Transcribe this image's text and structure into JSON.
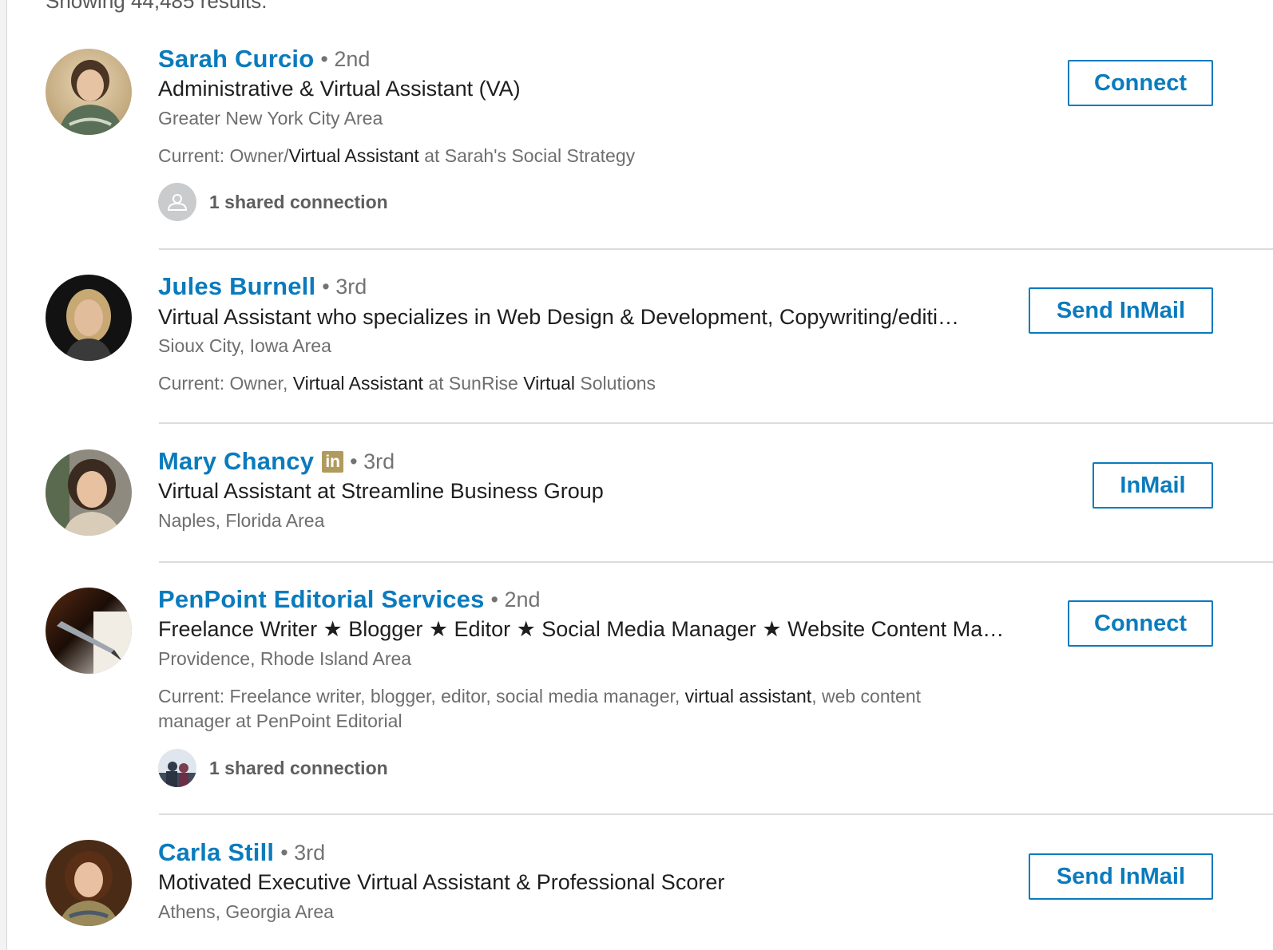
{
  "results_count": "Showing 44,485 results.",
  "results": [
    {
      "name": "Sarah Curcio",
      "degree": "• 2nd",
      "headline": "Administrative & Virtual Assistant (VA)",
      "location": "Greater New York City Area",
      "snippet": {
        "prefix": "Current: Owner/",
        "highlight": "Virtual Assistant",
        "suffix": " at Sarah's Social Strategy"
      },
      "shared": "1 shared connection",
      "action": "Connect"
    },
    {
      "name": "Jules Burnell",
      "degree": "• 3rd",
      "headline": "Virtual Assistant who specializes in Web Design & Development, Copywriting/editi…",
      "location": "Sioux City, Iowa Area",
      "snippet": {
        "prefix": "Current: Owner, ",
        "highlight": "Virtual Assistant",
        "middle": " at SunRise ",
        "highlight2": "Virtual",
        "suffix": " Solutions"
      },
      "action": "Send InMail"
    },
    {
      "name": "Mary Chancy",
      "badge": "in",
      "degree": "• 3rd",
      "headline": "Virtual Assistant at Streamline Business Group",
      "location": "Naples, Florida Area",
      "action": "InMail"
    },
    {
      "name": "PenPoint Editorial Services",
      "degree": "• 2nd",
      "headline": "Freelance Writer ★ Blogger ★ Editor ★ Social Media Manager ★ Website Content Ma…",
      "location": "Providence, Rhode Island Area",
      "snippet": {
        "prefix": "Current: Freelance writer, blogger, editor, social media manager, ",
        "highlight": "virtual assistant",
        "suffix": ", web content manager at PenPoint Editorial"
      },
      "shared": "1 shared connection",
      "action": "Connect"
    },
    {
      "name": "Carla Still",
      "degree": "• 3rd",
      "headline": "Motivated Executive Virtual Assistant & Professional Scorer",
      "location": "Athens, Georgia Area",
      "action": "Send InMail"
    }
  ],
  "colors": {
    "link": "#0a7bbd",
    "premium_badge": "#b19a5d",
    "divider": "#dcdcdc"
  },
  "icons": {
    "avatar": "profile-photo",
    "shared_placeholder": "person-silhouette-icon",
    "badge": "linkedin-premium-icon"
  }
}
